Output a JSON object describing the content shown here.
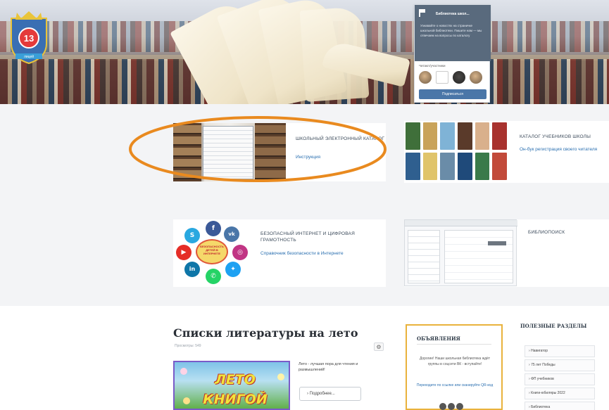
{
  "colors": {
    "accent": "#e98a1f",
    "link": "#2a6fb0",
    "vk_button": "#4a76a8",
    "ads_border": "#e9b23c"
  },
  "hero": {
    "crest_number": "13",
    "crest_ribbon": "лицей",
    "vk_widget": {
      "title": "Библиотека школ...",
      "text": "Узнавайте о новостях на страничке школьной библиотеки. Пишите нам — мы отвечаем на вопросы по каталогу",
      "members_label": "Читают/участники",
      "button_label": "Подписаться"
    }
  },
  "cards": {
    "catalog": {
      "title": "Школьный электронный каталог",
      "link": "Инструкция"
    },
    "textbooks": {
      "title": "Каталог учебников школы",
      "link": "Он-бук регистрация своего читателя"
    },
    "safe_internet": {
      "title": "Безопасный интернет и цифровая грамотность",
      "link": "Справочник безопасности в Интернете",
      "hub_text": "БЕЗОПАСНОСТЬ ДЕТЕЙ В ИНТЕРНЕТЕ"
    },
    "biblioteka": {
      "title": "БиблиоПоиск"
    }
  },
  "content": {
    "heading": "Списки литературы на лето",
    "meta": "Просмотры: 549",
    "image_words": [
      "ЛЕТО",
      "КНИГОЙ"
    ],
    "excerpt": "Лето - лучшая пора для чтения и размышлений!",
    "more_button": "Подробнее..."
  },
  "ads": {
    "title": "ОБЪЯВЛЕНИЯ",
    "text": "Дорогие! Наши школьная библиотека ждёт группы в соцсети ВК - вступайте!",
    "link": "Переходите по ссылке или сканируйте QR-код"
  },
  "useful": {
    "title": "ПОЛЕЗНЫЕ РАЗДЕЛЫ",
    "items": [
      "Навигатор",
      "75 лет Победы",
      "ФП учебников",
      "Книги-юбиляры 2022",
      "Библиотека"
    ]
  }
}
